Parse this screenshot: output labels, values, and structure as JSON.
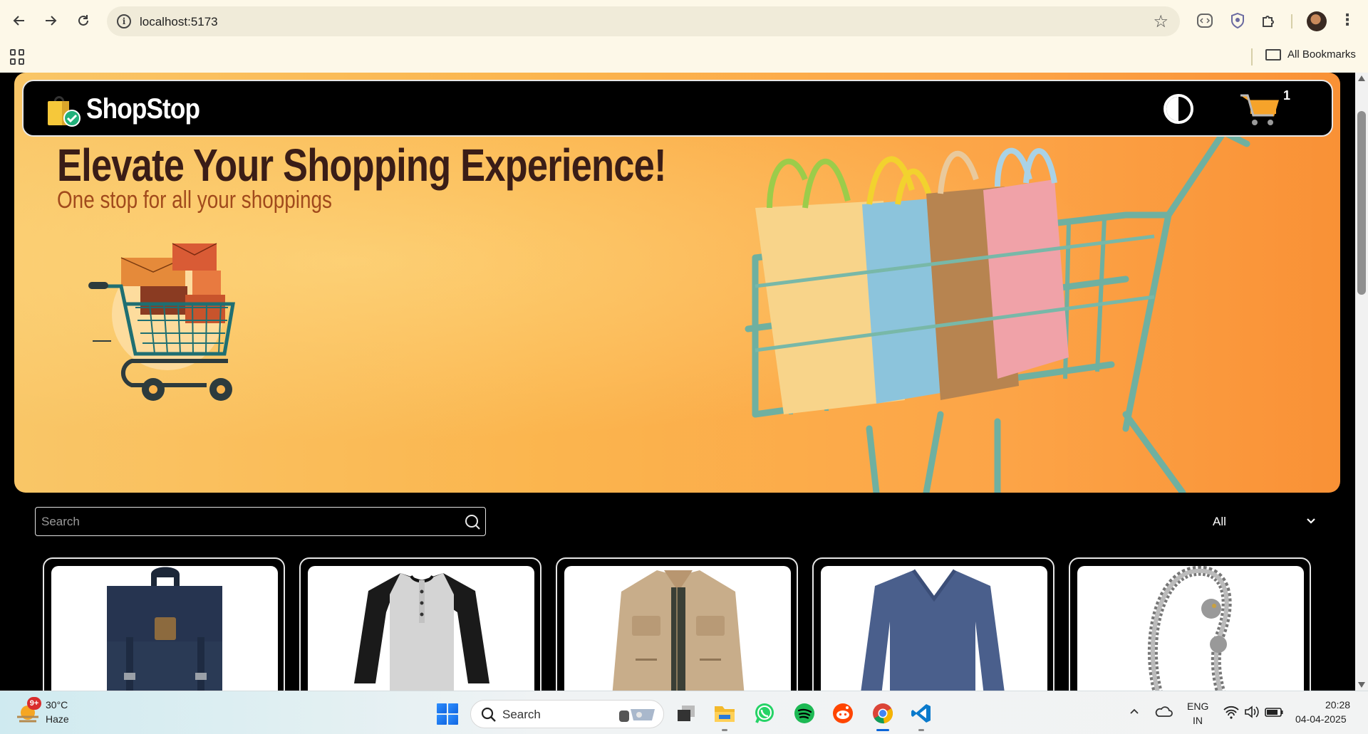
{
  "browser": {
    "url": "localhost:5173",
    "bookmarks_label": "All Bookmarks"
  },
  "header": {
    "logo_text": "ShopStop",
    "cart_count": "1"
  },
  "hero": {
    "title": "Elevate Your Shopping Experience!",
    "subtitle": "One stop for all your shoppings"
  },
  "search": {
    "placeholder": "Search"
  },
  "filter": {
    "selected": "All"
  },
  "products": [
    {
      "icon": "backpack-icon"
    },
    {
      "icon": "raglan-tshirt-icon"
    },
    {
      "icon": "jacket-icon"
    },
    {
      "icon": "sweater-icon"
    },
    {
      "icon": "bracelet-icon"
    }
  ],
  "taskbar": {
    "weather_badge": "9+",
    "temperature": "30°C",
    "condition": "Haze",
    "search_label": "Search",
    "lang_1": "ENG",
    "lang_2": "IN",
    "time": "20:28",
    "date": "04-04-2025"
  },
  "colors": {
    "hero_orange": "#fca447",
    "title_brown": "#3a1d17",
    "subtitle_rust": "#a14a1c",
    "header_black": "#000000"
  }
}
